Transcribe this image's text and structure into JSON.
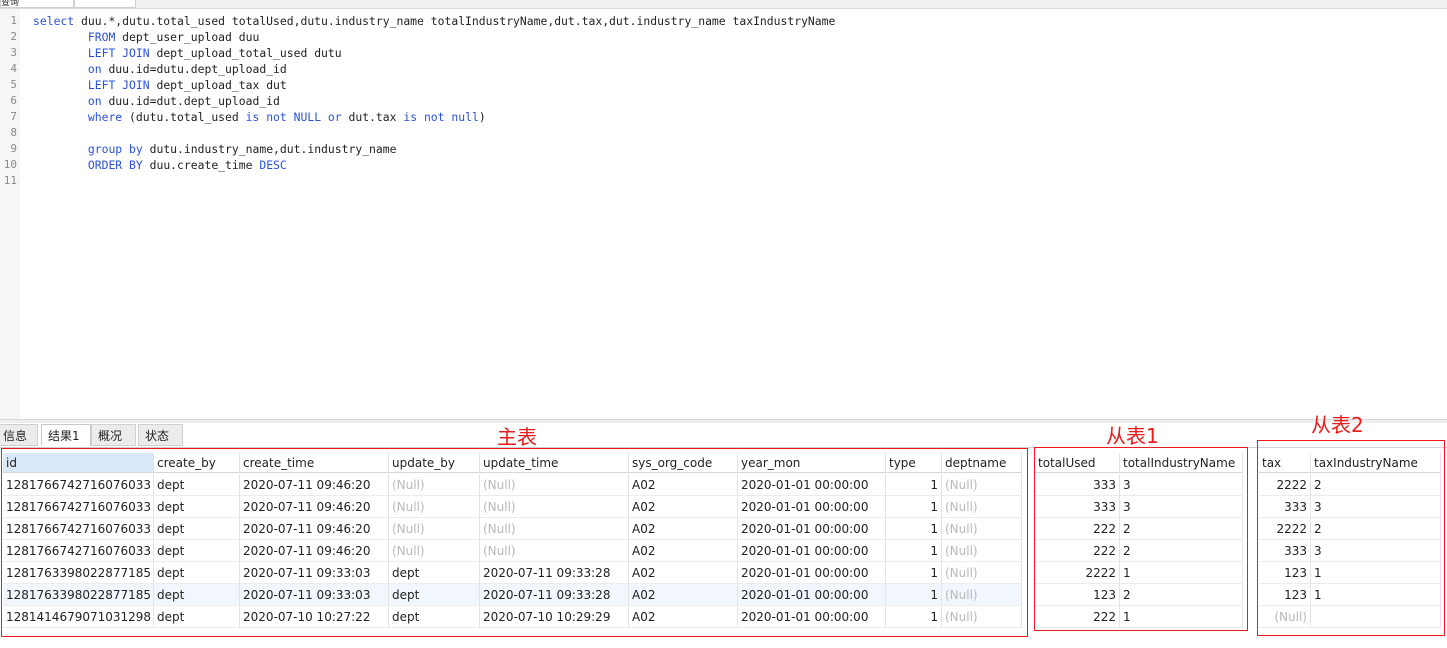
{
  "query_tabs": [
    {
      "label": "查询",
      "active": false
    },
    {
      "label": "",
      "active": true
    }
  ],
  "editor": {
    "line_numbers": [
      "1",
      "2",
      "3",
      "4",
      "5",
      "6",
      "7",
      "8",
      "9",
      "10",
      "11"
    ],
    "lines": [
      [
        {
          "t": "select ",
          "kw": true
        },
        {
          "t": "duu.*,dutu.total_used totalUsed,dutu.industry_name totalIndustryName,dut.tax,dut.industry_name taxIndustryName"
        }
      ],
      [
        {
          "t": "        "
        },
        {
          "t": "FROM",
          "kw": true
        },
        {
          "t": " dept_user_upload duu"
        }
      ],
      [
        {
          "t": "        "
        },
        {
          "t": "LEFT JOIN",
          "kw": true
        },
        {
          "t": " dept_upload_total_used dutu"
        }
      ],
      [
        {
          "t": "        "
        },
        {
          "t": "on",
          "kw": true
        },
        {
          "t": " duu.id=dutu.dept_upload_id"
        }
      ],
      [
        {
          "t": "        "
        },
        {
          "t": "LEFT JOIN",
          "kw": true
        },
        {
          "t": " dept_upload_tax dut"
        }
      ],
      [
        {
          "t": "        "
        },
        {
          "t": "on",
          "kw": true
        },
        {
          "t": " duu.id=dut.dept_upload_id"
        }
      ],
      [
        {
          "t": "        "
        },
        {
          "t": "where",
          "kw": true
        },
        {
          "t": " (dutu.total_used "
        },
        {
          "t": "is not NULL",
          "kw": true
        },
        {
          "t": " "
        },
        {
          "t": "or",
          "kw": true
        },
        {
          "t": " dut.tax "
        },
        {
          "t": "is not null",
          "kw": true
        },
        {
          "t": ")"
        }
      ],
      [],
      [
        {
          "t": "        "
        },
        {
          "t": "group by",
          "kw": true
        },
        {
          "t": " dutu.industry_name,dut.industry_name"
        }
      ],
      [
        {
          "t": "        "
        },
        {
          "t": "ORDER BY",
          "kw": true
        },
        {
          "t": " duu.create_time "
        },
        {
          "t": "DESC",
          "kw": true
        }
      ],
      []
    ]
  },
  "result_tabs": [
    {
      "label": "信息",
      "active": false
    },
    {
      "label": "结果1",
      "active": true
    },
    {
      "label": "概况",
      "active": false
    },
    {
      "label": "状态",
      "active": false
    }
  ],
  "colors": {
    "annotation_red": "#e81c1c",
    "keyword_blue": "#2b52d9",
    "null_gray": "#b9b9b9"
  },
  "grid1": {
    "columns": [
      "id",
      "create_by",
      "create_time",
      "update_by",
      "update_time",
      "sys_org_code",
      "year_mon",
      "type",
      "deptname"
    ],
    "rows": [
      [
        "1281766742716076033",
        "dept",
        "2020-07-11 09:46:20",
        "(Null)",
        "(Null)",
        "A02",
        "2020-01-01 00:00:00",
        "1",
        "(Null)"
      ],
      [
        "1281766742716076033",
        "dept",
        "2020-07-11 09:46:20",
        "(Null)",
        "(Null)",
        "A02",
        "2020-01-01 00:00:00",
        "1",
        "(Null)"
      ],
      [
        "1281766742716076033",
        "dept",
        "2020-07-11 09:46:20",
        "(Null)",
        "(Null)",
        "A02",
        "2020-01-01 00:00:00",
        "1",
        "(Null)"
      ],
      [
        "1281766742716076033",
        "dept",
        "2020-07-11 09:46:20",
        "(Null)",
        "(Null)",
        "A02",
        "2020-01-01 00:00:00",
        "1",
        "(Null)"
      ],
      [
        "1281763398022877185",
        "dept",
        "2020-07-11 09:33:03",
        "dept",
        "2020-07-11 09:33:28",
        "A02",
        "2020-01-01 00:00:00",
        "1",
        "(Null)"
      ],
      [
        "1281763398022877185",
        "dept",
        "2020-07-11 09:33:03",
        "dept",
        "2020-07-11 09:33:28",
        "A02",
        "2020-01-01 00:00:00",
        "1",
        "(Null)"
      ],
      [
        "1281414679071031298",
        "dept",
        "2020-07-10 10:27:22",
        "dept",
        "2020-07-10 10:29:29",
        "A02",
        "2020-01-01 00:00:00",
        "1",
        "(Null)"
      ]
    ]
  },
  "grid2": {
    "columns": [
      "totalUsed",
      "totalIndustryName"
    ],
    "rows": [
      [
        "333",
        "3"
      ],
      [
        "333",
        "3"
      ],
      [
        "222",
        "2"
      ],
      [
        "222",
        "2"
      ],
      [
        "2222",
        "1"
      ],
      [
        "123",
        "2"
      ],
      [
        "222",
        "1"
      ]
    ]
  },
  "grid3": {
    "columns": [
      "tax",
      "taxIndustryName"
    ],
    "rows": [
      [
        "2222",
        "2"
      ],
      [
        "333",
        "3"
      ],
      [
        "2222",
        "2"
      ],
      [
        "333",
        "3"
      ],
      [
        "123",
        "1"
      ],
      [
        "123",
        "1"
      ],
      [
        "(Null)",
        ""
      ]
    ]
  },
  "annotations": {
    "main_table": "主表",
    "sub_table_1": "从表1",
    "sub_table_2": "从表2"
  }
}
